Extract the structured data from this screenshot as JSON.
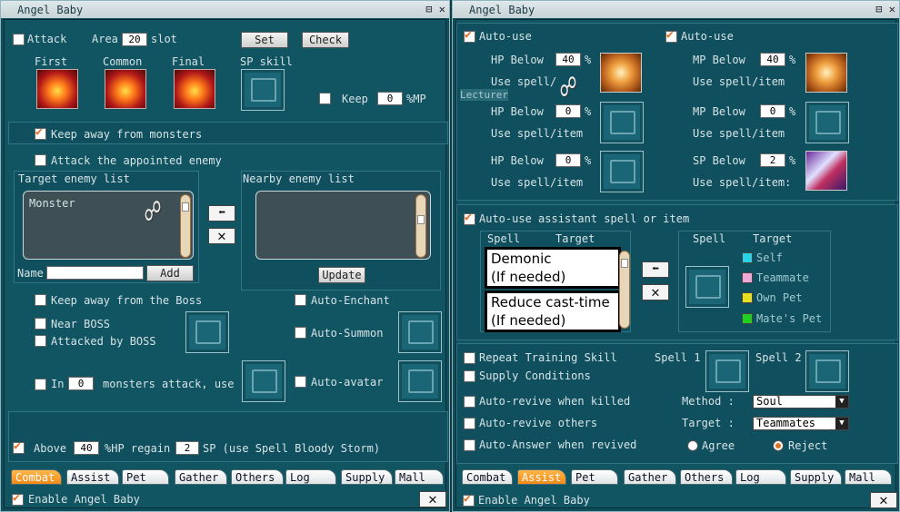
{
  "window_title": "Angel Baby",
  "left": {
    "attack_label": "Attack",
    "area_label": "Area",
    "area_value": "20",
    "slot_label": "slot",
    "set_button": "Set",
    "check_button": "Check",
    "first_label": "First",
    "common_label": "Common",
    "final_label": "Final",
    "sp_skill_label": "SP skill",
    "keep_label": "Keep",
    "keep_value": "0",
    "keep_unit": "%MP",
    "keep_away_monsters": "Keep away from monsters",
    "attack_appointed": "Attack the appointed enemy",
    "target_list_title": "Target enemy list",
    "target_list_items": [
      "Monster"
    ],
    "nearby_list_title": "Nearby enemy list",
    "name_label": "Name",
    "add_button": "Add",
    "update_button": "Update",
    "keep_away_boss": "Keep away from the Boss",
    "auto_enchant": "Auto-Enchant",
    "near_boss": "Near BOSS",
    "attacked_by_boss": "Attacked by BOSS",
    "auto_summon": "Auto-Summon",
    "in_label": "In",
    "in_value": "0",
    "monsters_attack_use": "monsters attack, use",
    "auto_avatar": "Auto-avatar",
    "above_label": "Above",
    "above_value": "40",
    "hp_regain_label": "%HP regain",
    "regain_value": "2",
    "sp_use_label": "SP (use Spell Bloody Storm)",
    "enable_label": "Enable Angel Baby"
  },
  "right": {
    "auto_use_1": "Auto-use",
    "auto_use_2": "Auto-use",
    "hp_below": "HP Below",
    "mp_below": "MP Below",
    "sp_below": "SP Below",
    "hp1_value": "40",
    "mp1_value": "40",
    "hp2_value": "0",
    "mp2_value": "0",
    "hp3_value": "0",
    "sp_value": "2",
    "pct": "%",
    "use_spell_item_1": "Use spell/",
    "use_spell_item": "Use spell/item",
    "use_spell_item_colon": "Use spell/item:",
    "lecturer_overlay": "Lecturer",
    "auto_use_assistant": "Auto-use assistant spell or item",
    "spell_header": "Spell",
    "target_header": "Target",
    "spell_box_1": [
      "Demonic",
      "(If needed)"
    ],
    "spell_box_2": [
      "Reduce cast-time",
      "(If needed)"
    ],
    "target_options": [
      "Self",
      "Teammate",
      "Own Pet",
      "Mate's Pet"
    ],
    "target_colors": [
      "#27d4e8",
      "#f0a8d8",
      "#e8e020",
      "#20d020"
    ],
    "repeat_training": "Repeat Training Skill",
    "supply_conditions": "Supply Conditions",
    "spell1": "Spell 1",
    "spell2": "Spell 2",
    "auto_revive_killed": "Auto-revive when killed",
    "method_label": "Method :",
    "method_value": "Soul",
    "auto_revive_others": "Auto-revive others",
    "target_label": "Target :",
    "target_value": "Teammates",
    "auto_answer": "Auto-Answer when revived",
    "agree_label": "Agree",
    "reject_label": "Reject",
    "enable_label": "Enable Angel Baby"
  },
  "tabs": [
    "Combat",
    "Assist",
    "Pet",
    "Gather",
    "Others",
    "Log",
    "Supply",
    "Mall"
  ],
  "left_active_tab": "Combat",
  "right_active_tab": "Assist"
}
